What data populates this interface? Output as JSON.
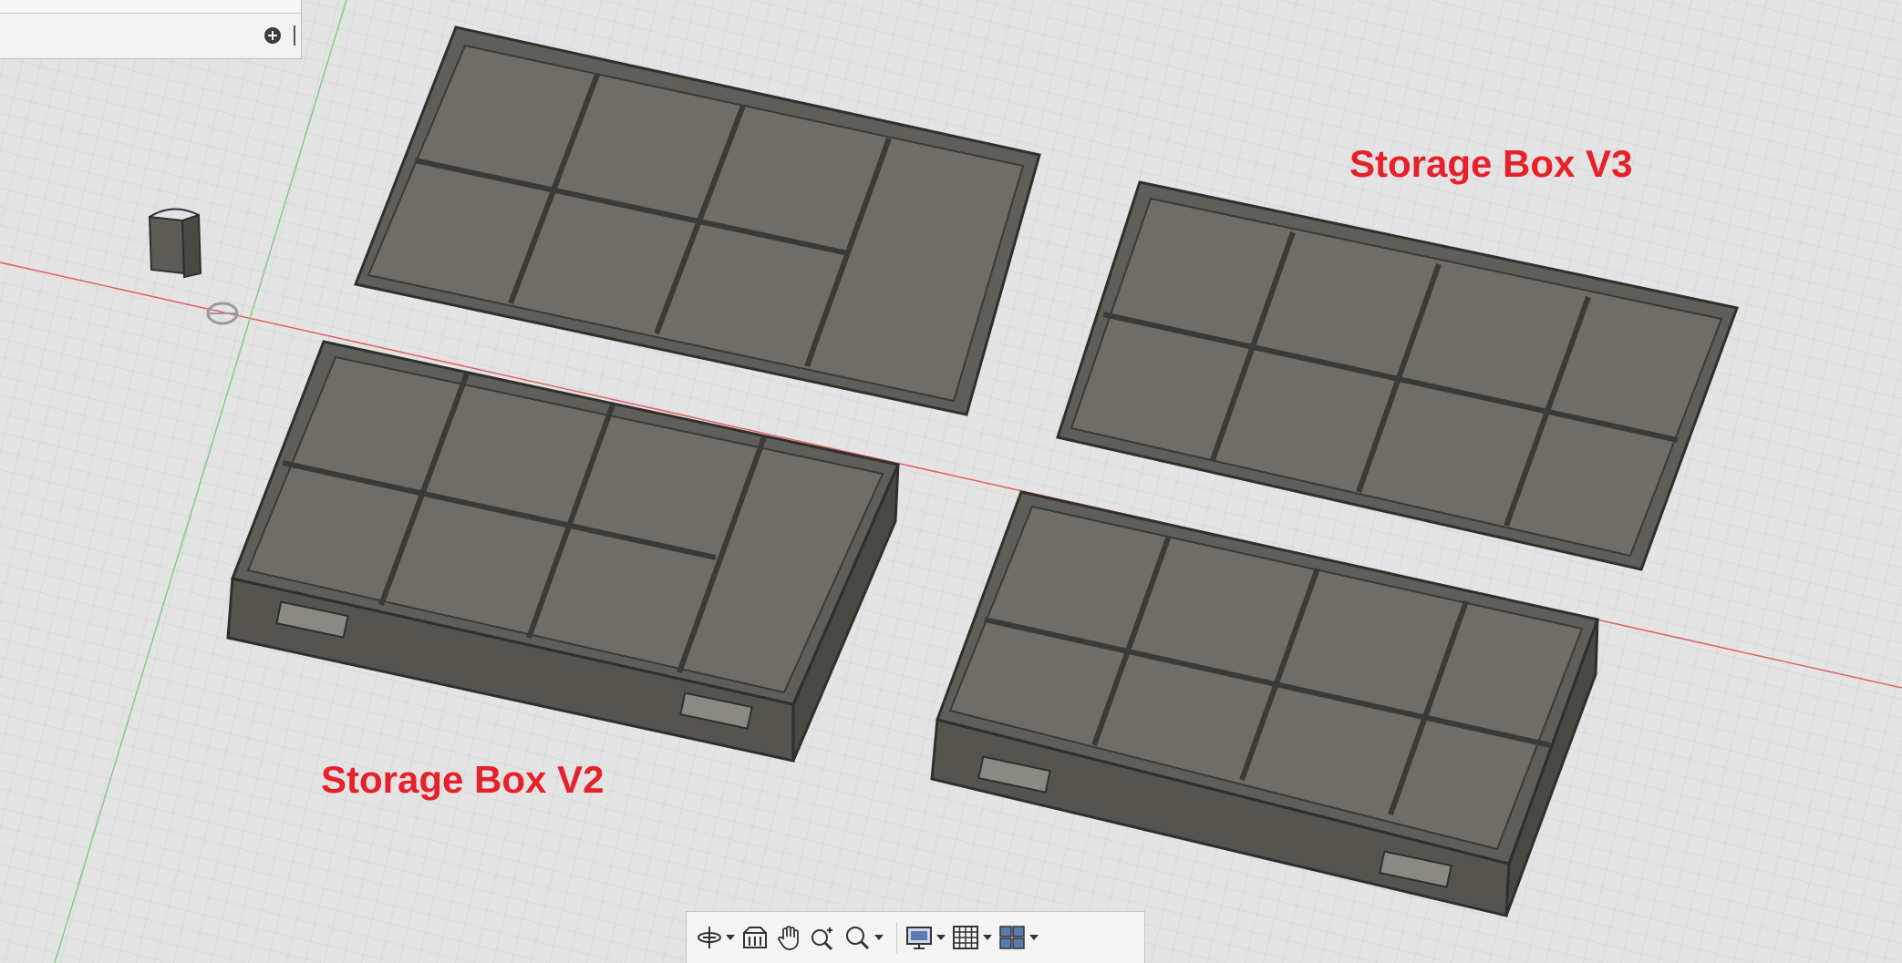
{
  "labels": {
    "v3": "Storage Box V3",
    "v2": "Storage Box V2"
  },
  "browser_panel": {
    "add_icon": "plus-circle-icon"
  },
  "navigation_toolbar": {
    "tools": [
      {
        "id": "orbit",
        "icon": "orbit-icon",
        "has_dropdown": true
      },
      {
        "id": "look-at",
        "icon": "look-at-icon",
        "has_dropdown": false
      },
      {
        "id": "pan",
        "icon": "pan-hand-icon",
        "has_dropdown": false
      },
      {
        "id": "zoom",
        "icon": "zoom-icon",
        "has_dropdown": false
      },
      {
        "id": "fit",
        "icon": "zoom-window-icon",
        "has_dropdown": true
      },
      {
        "id": "display-settings",
        "icon": "display-monitor-icon",
        "has_dropdown": true
      },
      {
        "id": "grid-snaps",
        "icon": "grid-icon",
        "has_dropdown": true
      },
      {
        "id": "viewports",
        "icon": "viewports-icon",
        "has_dropdown": true
      }
    ]
  },
  "colors": {
    "background": "#e4e4e4",
    "grid_line": "#cfcfcf",
    "x_axis": "#e06060",
    "y_axis": "#7fd07f",
    "box_body": "#5f5e58",
    "box_floor": "#6f6d66",
    "label_red": "#e8202a"
  }
}
